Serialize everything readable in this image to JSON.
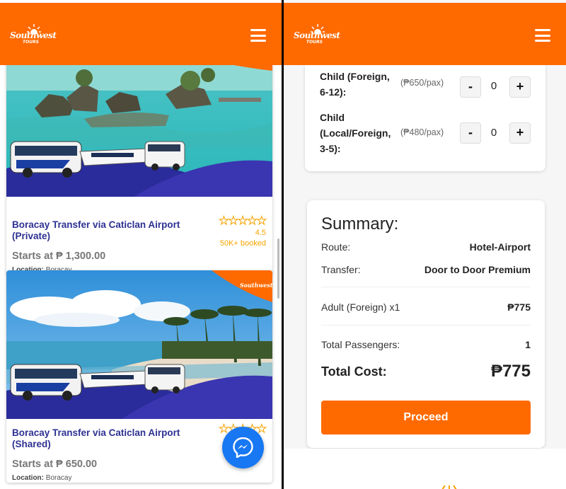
{
  "brand": {
    "name": "Southwest",
    "sub": "TOURS",
    "accent": "#ff6a00",
    "title_color": "#2e3192"
  },
  "left": {
    "cards": [
      {
        "title": "Boracay Transfer via Caticlan Airport (Private)",
        "price": "Starts at ₱ 1,300.00",
        "location_label": "Location:",
        "location": "Boracay",
        "stars": 5,
        "rating": "4.5",
        "booked": "50K+ booked",
        "image_badge": "Southwest"
      },
      {
        "title": "Boracay Transfer via Caticlan Airport (Shared)",
        "price": "Starts at ₱ 650.00",
        "location_label": "Location:",
        "location": "Boracay",
        "stars": 5,
        "image_badge": "Southwest"
      }
    ],
    "icons": [
      "menu-icon",
      "star-icon",
      "messenger-icon"
    ]
  },
  "right": {
    "passengers": [
      {
        "label": "Child (Foreign, 6-12):",
        "price": "(₱650/pax)",
        "count": "0",
        "minus": "-",
        "plus": "+"
      },
      {
        "label": "Child (Local/Foreign, 3-5):",
        "price": "(₱480/pax)",
        "count": "0",
        "minus": "-",
        "plus": "+"
      }
    ],
    "summary": {
      "heading": "Summary:",
      "route_label": "Route:",
      "route_value": "Hotel-Airport",
      "transfer_label": "Transfer:",
      "transfer_value": "Door to Door Premium",
      "adult_label": "Adult (Foreign) x1",
      "adult_value": "₱775",
      "total_pax_label": "Total Passengers:",
      "total_pax_value": "1",
      "total_cost_label": "Total Cost:",
      "total_cost_value": "₱775",
      "proceed_label": "Proceed"
    }
  }
}
